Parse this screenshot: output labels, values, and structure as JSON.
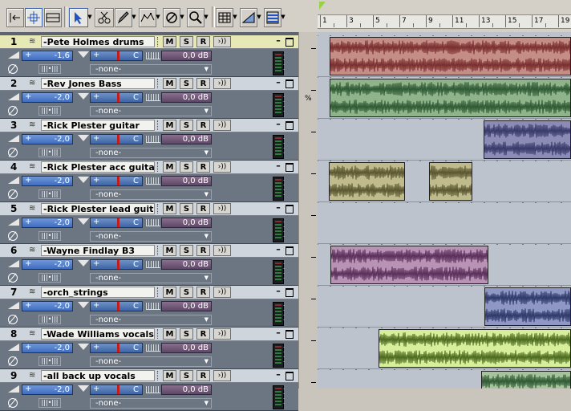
{
  "toolbar": {
    "tools": [
      {
        "icon": "snap-to-left-icon"
      },
      {
        "icon": "move-cross-icon"
      },
      {
        "icon": "select-region-icon"
      },
      {
        "icon": "pointer-tool-icon"
      },
      {
        "icon": "scissors-tool-icon"
      },
      {
        "icon": "draw-tool-icon"
      },
      {
        "icon": "envelope-tool-icon"
      },
      {
        "icon": "mute-tool-icon"
      },
      {
        "icon": "zoom-tool-icon"
      },
      {
        "icon": "grid-tool-icon"
      },
      {
        "icon": "volume-tool-icon"
      },
      {
        "icon": "track-view-tool-icon"
      }
    ]
  },
  "ruler": {
    "labels": [
      "1",
      "3",
      "5",
      "7",
      "9",
      "11",
      "13",
      "15",
      "17",
      "19"
    ]
  },
  "tracks": [
    {
      "num": "1",
      "name": "-Pete Holmes drums",
      "volume": "-1,6",
      "pan": "C",
      "trim": "0,0 dB",
      "output": "-none-",
      "selected": true,
      "clipColor": "#c48d86",
      "waveColor": "#7a2f2f"
    },
    {
      "num": "2",
      "name": "-Rev Jones Bass",
      "volume": "-2,0",
      "pan": "C",
      "trim": "0,0 dB",
      "output": "-none-",
      "selected": false,
      "clipColor": "#8fb38a",
      "waveColor": "#2f5a34"
    },
    {
      "num": "3",
      "name": "-Rick Plester guitar",
      "volume": "-2,0",
      "pan": "C",
      "trim": "0,0 dB",
      "output": "-none-",
      "selected": false,
      "clipColor": "#8b8bb5",
      "waveColor": "#3a3a6a"
    },
    {
      "num": "4",
      "name": "-Rick Plester acc guitar",
      "volume": "-2,0",
      "pan": "C",
      "trim": "0,0 dB",
      "output": "-none-",
      "selected": false,
      "clipColor": "#bfbb8c",
      "waveColor": "#5a5630"
    },
    {
      "num": "5",
      "name": "-Rick Plester lead guitar",
      "volume": "-2,0",
      "pan": "C",
      "trim": "0,0 dB",
      "output": "-none-",
      "selected": false,
      "clipColor": "",
      "waveColor": ""
    },
    {
      "num": "6",
      "name": "-Wayne Findlay B3",
      "volume": "-2,0",
      "pan": "C",
      "trim": "0,0 dB",
      "output": "-none-",
      "selected": false,
      "clipColor": "#b993b6",
      "waveColor": "#5a2f5a"
    },
    {
      "num": "7",
      "name": "-orch_strings",
      "volume": "-2,0",
      "pan": "C",
      "trim": "0,0 dB",
      "output": "-none-",
      "selected": false,
      "clipColor": "#8f97c4",
      "waveColor": "#2f3a6a"
    },
    {
      "num": "8",
      "name": "-Wade Williams vocals",
      "volume": "-2,0",
      "pan": "C",
      "trim": "0,0 dB",
      "output": "-none-",
      "selected": false,
      "clipColor": "#d7ee9a",
      "waveColor": "#4c6a1e"
    },
    {
      "num": "9",
      "name": "-all back up vocals",
      "volume": "-2,0",
      "pan": "C",
      "trim": "0,0 dB",
      "output": "-none-",
      "selected": false,
      "clipColor": "#a6c39c",
      "waveColor": "#2f5a34"
    }
  ],
  "labels": {
    "mute": "M",
    "solo": "S",
    "record": "R",
    "input_echo": "›))",
    "interleave": "|||•|||",
    "minimize": "–",
    "split_percent": "%"
  },
  "colors": {
    "selected_track_header": "#e6e8b6",
    "track_header": "#cfd5dc",
    "volume_slider": "#3f6cc0",
    "pan_center": "#c21d1d",
    "trim_slider": "#5d4766",
    "timeline_start_marker": "#9bd04a"
  }
}
